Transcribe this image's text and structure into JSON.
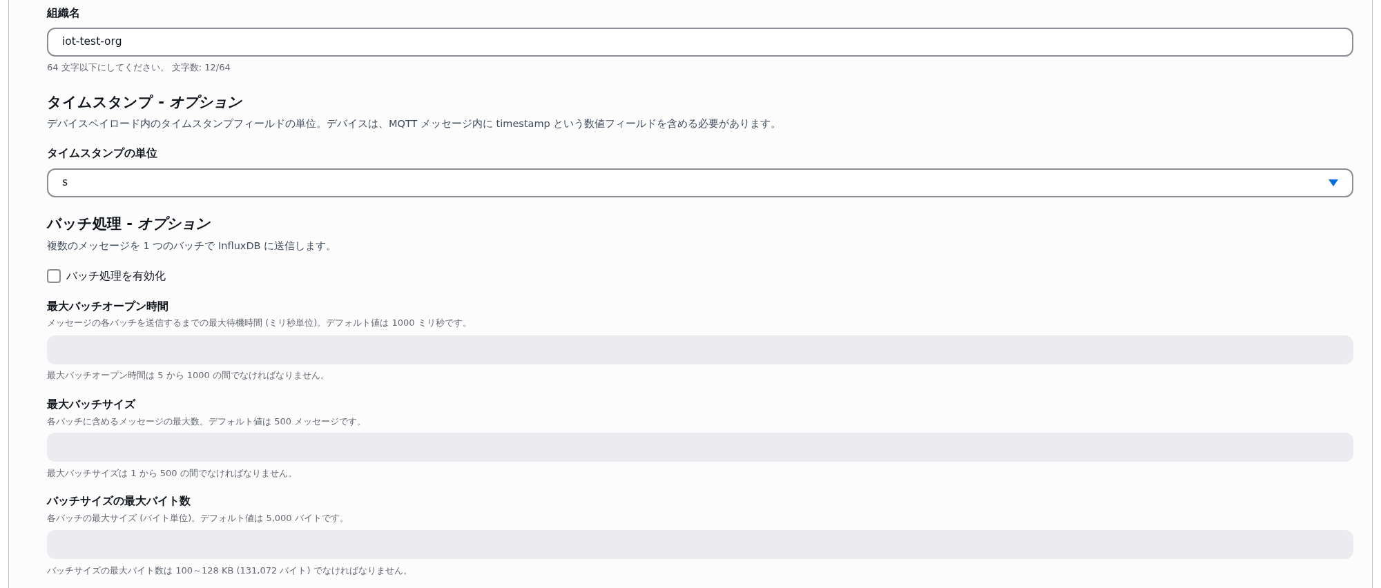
{
  "organization": {
    "label": "組織名",
    "value": "iot-test-org",
    "hint": "64 文字以下にしてください。 文字数: 12/64"
  },
  "timestamp": {
    "heading": "タイムスタンプ - *オプション*",
    "description": "デバイスペイロード内のタイムスタンプフィールドの単位。デバイスは、MQTT メッセージ内に timestamp という数値フィールドを含める必要があります。",
    "unit_label": "タイムスタンプの単位",
    "unit_value": "s"
  },
  "batching": {
    "heading": "バッチ処理 - *オプション*",
    "description": "複数のメッセージを 1 つのバッチで InfluxDB に送信します。",
    "enable": {
      "label": "バッチ処理を有効化",
      "checked": false
    },
    "fields": [
      {
        "label": "最大バッチオープン時間",
        "description": "メッセージの各バッチを送信するまでの最大待機時間 (ミリ秒単位)。デフォルト値は 1000 ミリ秒です。",
        "disabled": true,
        "constraint": "最大バッチオープン時間は 5 から 1000 の間でなければなりません。"
      },
      {
        "label": "最大バッチサイズ",
        "description": "各バッチに含めるメッセージの最大数。デフォルト値は 500 メッセージです。",
        "disabled": true,
        "constraint": "最大バッチサイズは 1 から 500 の間でなければなりません。"
      },
      {
        "label": "バッチサイズの最大バイト数",
        "description": "各バッチの最大サイズ (バイト単位)。デフォルト値は 5,000 バイトです。",
        "disabled": true,
        "constraint": "バッチサイズの最大バイト数は 100～128 KB (131,072 バイト) でなければなりません。"
      }
    ]
  }
}
